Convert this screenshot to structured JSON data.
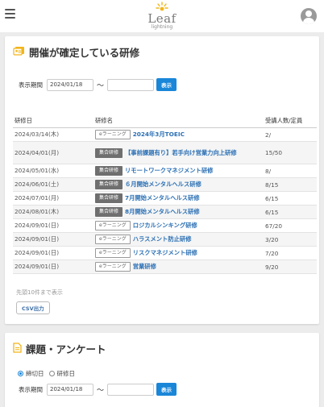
{
  "header": {
    "logo_text": "Leaf",
    "logo_sub": "lightning"
  },
  "confirmed": {
    "title": "開催が確定している研修",
    "period_label": "表示期間",
    "date_from": "2024/01/18",
    "date_to": "",
    "tilde": "〜",
    "show_label": "表示",
    "columns": [
      "研修日",
      "研修名",
      "受講人数/定員"
    ],
    "rows": [
      {
        "date": "2024/03/14(木)",
        "badge": "eラーニング",
        "badge_type": "elearn",
        "name": "2024年3月TOEIC",
        "count": "2/"
      },
      {
        "date": "2024/04/01(月)",
        "badge": "集合研修",
        "badge_type": "group",
        "name": "【事前課題有り】若手向け営業力向上研修",
        "count": "15/50"
      },
      {
        "date": "2024/05/01(水)",
        "badge": "集合研修",
        "badge_type": "group",
        "name": "リモートワークマネジメント研修",
        "count": "8/"
      },
      {
        "date": "2024/06/01(土)",
        "badge": "集合研修",
        "badge_type": "group",
        "name": "６月開始メンタルヘルス研修",
        "count": "8/15"
      },
      {
        "date": "2024/07/01(月)",
        "badge": "集合研修",
        "badge_type": "group",
        "name": "7月開始メンタルヘルス研修",
        "count": "6/15"
      },
      {
        "date": "2024/08/01(木)",
        "badge": "集合研修",
        "badge_type": "group",
        "name": "8月開始メンタルヘルス研修",
        "count": "6/15"
      },
      {
        "date": "2024/09/01(日)",
        "badge": "eラーニング",
        "badge_type": "elearn",
        "name": "ロジカルシンキング研修",
        "count": "67/20"
      },
      {
        "date": "2024/09/01(日)",
        "badge": "eラーニング",
        "badge_type": "elearn",
        "name": "ハラスメント防止研修",
        "count": "3/20"
      },
      {
        "date": "2024/09/01(日)",
        "badge": "eラーニング",
        "badge_type": "elearn",
        "name": "リスクマネジメント研修",
        "count": "7/20"
      },
      {
        "date": "2024/09/01(日)",
        "badge": "eラーニング",
        "badge_type": "elearn",
        "name": "営業研修",
        "count": "9/20"
      }
    ],
    "note": "先頭10件まで表示",
    "csv_label": "CSV出力"
  },
  "tasks": {
    "title": "課題・アンケート",
    "radio_deadline": "締切日",
    "radio_training": "研修日",
    "period_label": "表示期間",
    "date_from": "2024/01/18",
    "date_to": "",
    "tilde": "〜",
    "show_label": "表示"
  },
  "colors": {
    "accent": "#1a86d8",
    "link": "#2a6fb4",
    "icon_yellow": "#f2b51b"
  }
}
